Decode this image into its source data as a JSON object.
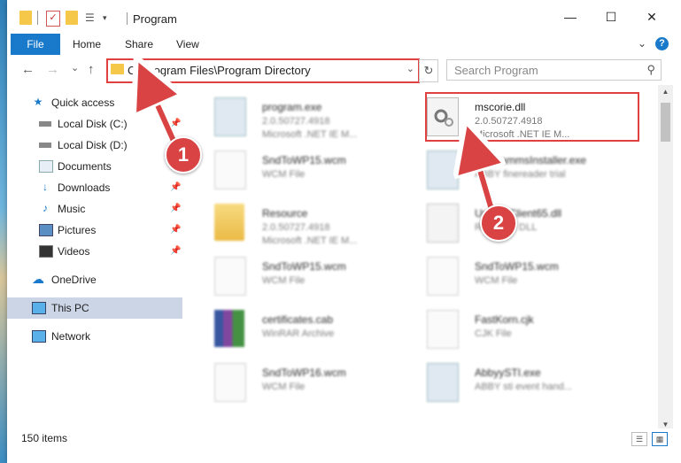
{
  "window": {
    "title": "Program",
    "controls": {
      "minimize": "—",
      "maximize": "☐",
      "close": "✕"
    }
  },
  "ribbon": {
    "tabs": [
      "File",
      "Home",
      "Share",
      "View"
    ],
    "help": "?"
  },
  "address": {
    "path": "C:\\Program Files\\Program Directory",
    "refresh": "↻",
    "search_placeholder": "Search Program"
  },
  "nav": {
    "back": "←",
    "forward": "→",
    "recent": "⌄",
    "up": "↑",
    "items": [
      {
        "label": "Quick access",
        "icon": "star-icon",
        "pinned": false
      },
      {
        "label": "Local Disk (C:)",
        "icon": "drive-icon",
        "pinned": true
      },
      {
        "label": "Local Disk (D:)",
        "icon": "drive-icon",
        "pinned": true
      },
      {
        "label": "Documents",
        "icon": "documents-icon",
        "pinned": true
      },
      {
        "label": "Downloads",
        "icon": "download-icon",
        "pinned": true
      },
      {
        "label": "Music",
        "icon": "music-icon",
        "pinned": true
      },
      {
        "label": "Pictures",
        "icon": "pictures-icon",
        "pinned": true
      },
      {
        "label": "Videos",
        "icon": "videos-icon",
        "pinned": true
      },
      {
        "label": "OneDrive",
        "icon": "cloud-icon",
        "pinned": false
      },
      {
        "label": "This PC",
        "icon": "computer-icon",
        "pinned": false
      },
      {
        "label": "Network",
        "icon": "network-icon",
        "pinned": false
      }
    ]
  },
  "files": [
    {
      "name": "program.exe",
      "line1": "2.0.50727.4918",
      "line2": "Microsoft .NET IE M...",
      "kind": "exe"
    },
    {
      "name": "mscorie.dll",
      "line1": "2.0.50727.4918",
      "line2": "Microsoft .NET IE M...",
      "kind": "dll"
    },
    {
      "name": "SndToWP15.wcm",
      "line1": "WCM File",
      "line2": "",
      "kind": "doc"
    },
    {
      "name": "ProgrammsInstaller.exe",
      "line1": "ABBY finereader trial",
      "line2": "",
      "kind": "exe"
    },
    {
      "name": "Resource",
      "line1": "2.0.50727.4918",
      "line2": "Microsoft .NET IE M...",
      "kind": "folder"
    },
    {
      "name": "UpdateClient65.dll",
      "line1": "Resource DLL",
      "line2": "",
      "kind": "dll"
    },
    {
      "name": "SndToWP15.wcm",
      "line1": "WCM File",
      "line2": "",
      "kind": "doc"
    },
    {
      "name": "SndToWP15.wcm",
      "line1": "WCM File",
      "line2": "",
      "kind": "doc"
    },
    {
      "name": "certificates.cab",
      "line1": "WinRAR Archive",
      "line2": "",
      "kind": "rar"
    },
    {
      "name": "FastKorn.cjk",
      "line1": "CJK File",
      "line2": "",
      "kind": "doc"
    },
    {
      "name": "SndToWP16.wcm",
      "line1": "WCM File",
      "line2": "",
      "kind": "doc"
    },
    {
      "name": "AbbyySTI.exe",
      "line1": "ABBY sti event hand...",
      "line2": "",
      "kind": "exe"
    }
  ],
  "status": {
    "item_count": "150 items"
  },
  "callouts": {
    "one": "1",
    "two": "2"
  },
  "colors": {
    "accent": "#1979ca",
    "highlight": "#e04040",
    "callout": "#d94343"
  }
}
